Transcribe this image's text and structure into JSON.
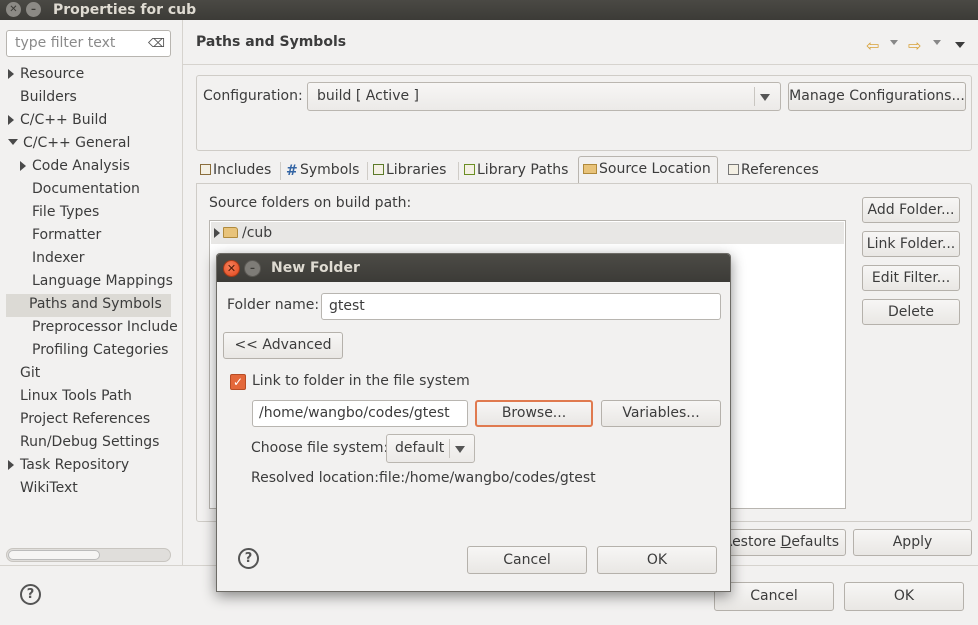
{
  "window": {
    "title": "Properties for cub"
  },
  "filter": {
    "placeholder": "type filter text"
  },
  "tree": [
    {
      "label": "Resource",
      "expander": "collapsed",
      "indent": 0
    },
    {
      "label": "Builders",
      "expander": "none",
      "indent": 0
    },
    {
      "label": "C/C++ Build",
      "expander": "collapsed",
      "indent": 0
    },
    {
      "label": "C/C++ General",
      "expander": "expanded",
      "indent": 0
    },
    {
      "label": "Code Analysis",
      "expander": "collapsed",
      "indent": 1
    },
    {
      "label": "Documentation",
      "expander": "none",
      "indent": 1
    },
    {
      "label": "File Types",
      "expander": "none",
      "indent": 1
    },
    {
      "label": "Formatter",
      "expander": "none",
      "indent": 1
    },
    {
      "label": "Indexer",
      "expander": "none",
      "indent": 1
    },
    {
      "label": "Language Mappings",
      "expander": "none",
      "indent": 1
    },
    {
      "label": "Paths and Symbols",
      "expander": "none",
      "indent": 1,
      "selected": true
    },
    {
      "label": "Preprocessor Include",
      "expander": "none",
      "indent": 1
    },
    {
      "label": "Profiling Categories",
      "expander": "none",
      "indent": 1
    },
    {
      "label": "Git",
      "expander": "none",
      "indent": 0
    },
    {
      "label": "Linux Tools Path",
      "expander": "none",
      "indent": 0
    },
    {
      "label": "Project References",
      "expander": "none",
      "indent": 0
    },
    {
      "label": "Run/Debug Settings",
      "expander": "none",
      "indent": 0
    },
    {
      "label": "Task Repository",
      "expander": "collapsed",
      "indent": 0
    },
    {
      "label": "WikiText",
      "expander": "none",
      "indent": 0
    }
  ],
  "page": {
    "title": "Paths and Symbols"
  },
  "config": {
    "label": "Configuration:",
    "value": "build  [ Active ]",
    "manage_button": "Manage Configurations..."
  },
  "tabs": [
    {
      "label": "Includes",
      "icon": "includes-icon"
    },
    {
      "label": "Symbols",
      "icon": "hash-icon"
    },
    {
      "label": "Libraries",
      "icon": "libraries-icon"
    },
    {
      "label": "Library Paths",
      "icon": "library-paths-icon"
    },
    {
      "label": "Source Location",
      "icon": "folder-icon",
      "active": true
    },
    {
      "label": "References",
      "icon": "references-icon"
    }
  ],
  "source": {
    "label": "Source folders on build path:",
    "items": [
      "/cub"
    ]
  },
  "side_buttons": {
    "add_folder": "Add Folder...",
    "link_folder": "Link Folder...",
    "edit_filter": "Edit Filter...",
    "delete": "Delete"
  },
  "footer": {
    "restore_pre": "Restore ",
    "restore_mnemonic": "D",
    "restore_post": "efaults",
    "apply": "Apply",
    "cancel": "Cancel",
    "ok": "OK"
  },
  "dialog": {
    "title": "New Folder",
    "folder_name_label": "Folder name:",
    "folder_name_value": "gtest",
    "advanced_button": "<< Advanced",
    "link_checkbox_label": "Link to folder in the file system",
    "link_checked": true,
    "path_value": "/home/wangbo/codes/gtest",
    "browse_button": "Browse...",
    "variables_button": "Variables...",
    "fs_label": "Choose file system:",
    "fs_value": "default",
    "resolved_label": "Resolved location:",
    "resolved_value": "file:/home/wangbo/codes/gtest",
    "cancel_button": "Cancel",
    "ok_button": "OK"
  }
}
